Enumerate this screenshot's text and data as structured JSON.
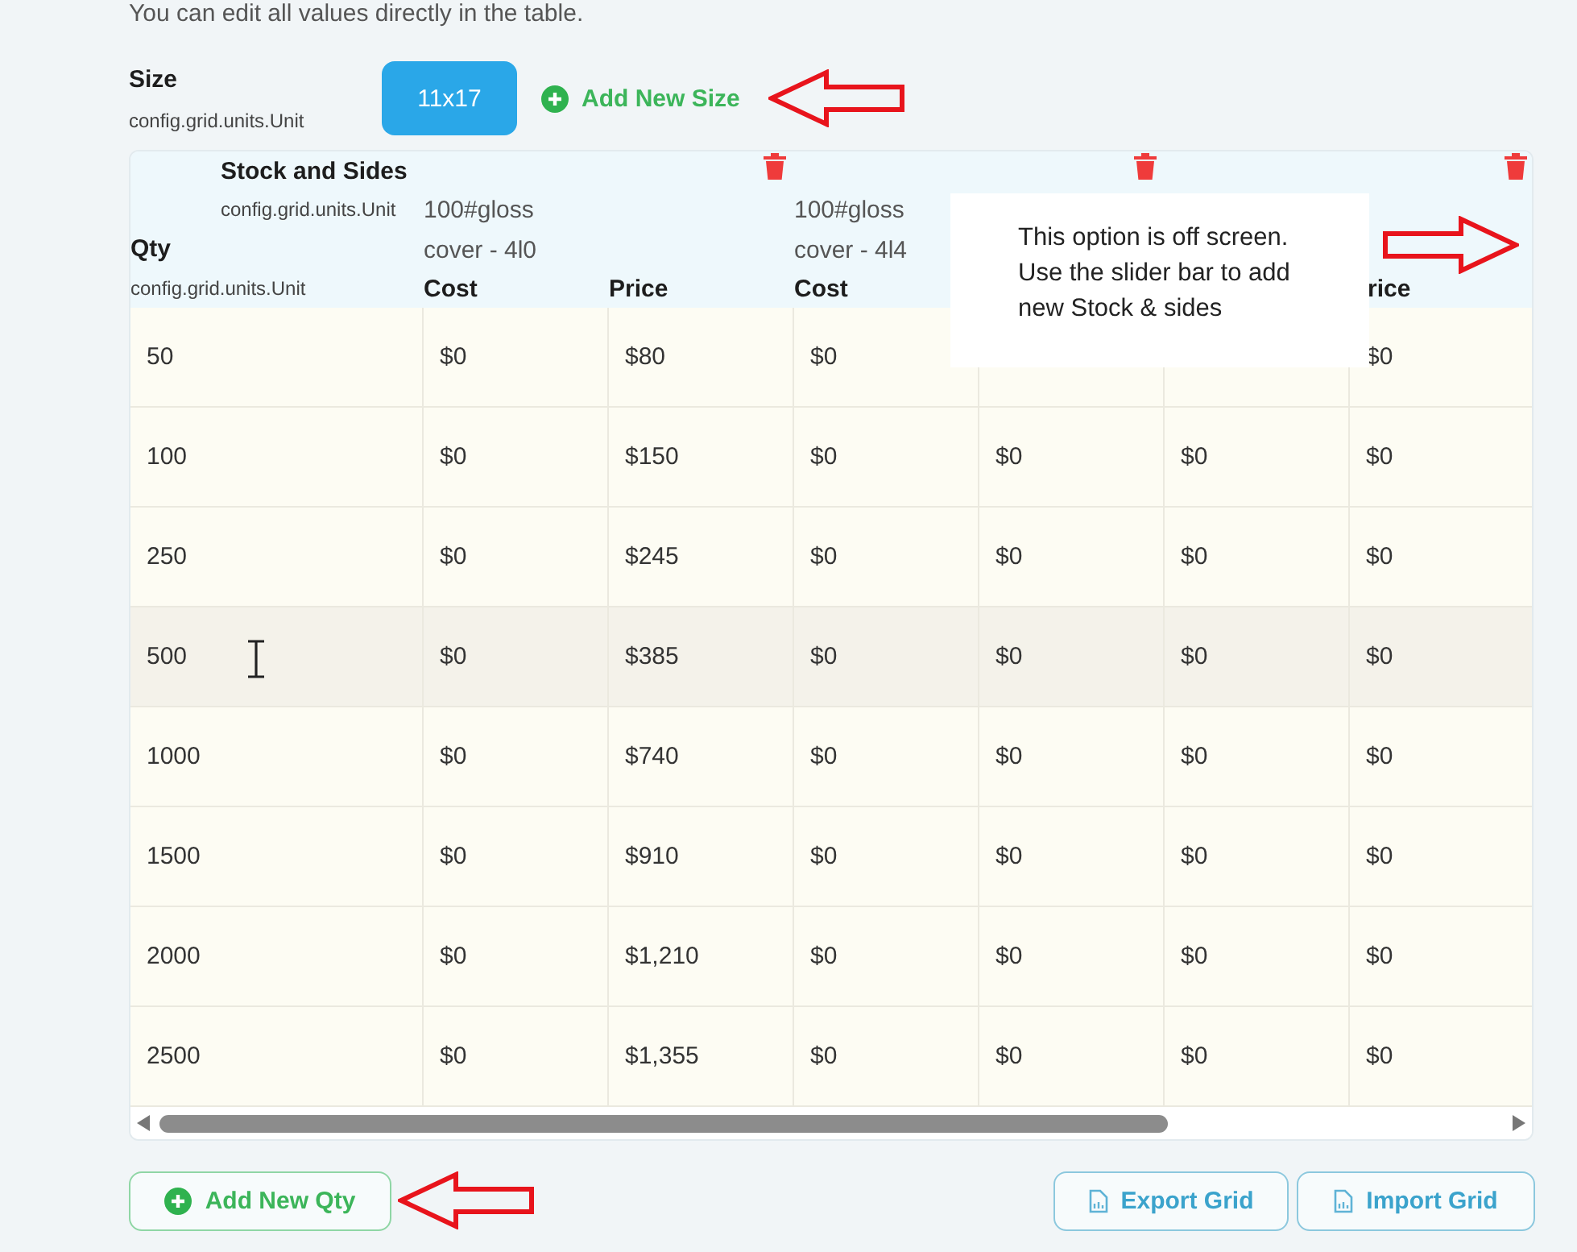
{
  "intro": "You can edit all values directly in the table.",
  "size": {
    "label": "Size",
    "sublabel": "config.grid.units.Unit",
    "options": [
      {
        "label": "11x17",
        "selected": true
      }
    ],
    "add_button": "Add New Size"
  },
  "grid": {
    "title": "Stock and Sides",
    "title_sublabel": "config.grid.units.Unit",
    "qty_label": "Qty",
    "qty_sublabel": "config.grid.units.Unit",
    "stocks": [
      {
        "lines": [
          "100#gloss",
          "cover - 4l0"
        ],
        "columns": [
          {
            "label": "Cost"
          },
          {
            "label": "Price"
          }
        ]
      },
      {
        "lines": [
          "100#gloss",
          "cover - 4l4"
        ],
        "columns": [
          {
            "label": "Cost"
          },
          {
            "covered": true
          }
        ]
      },
      {
        "columns": [
          {
            "covered": true
          },
          {
            "label": "rice"
          }
        ]
      }
    ],
    "rows": [
      {
        "qty": "50",
        "values": [
          "$0",
          "$80",
          "$0",
          {
            "covered": true
          },
          {
            "covered": true
          },
          "$0"
        ],
        "hovered": false
      },
      {
        "qty": "100",
        "values": [
          "$0",
          "$150",
          "$0",
          "$0",
          "$0",
          "$0"
        ],
        "hovered": false
      },
      {
        "qty": "250",
        "values": [
          "$0",
          "$245",
          "$0",
          "$0",
          "$0",
          "$0"
        ],
        "hovered": false
      },
      {
        "qty": "500",
        "values": [
          "$0",
          "$385",
          "$0",
          "$0",
          "$0",
          "$0"
        ],
        "hovered": true
      },
      {
        "qty": "1000",
        "values": [
          "$0",
          "$740",
          "$0",
          "$0",
          "$0",
          "$0"
        ],
        "hovered": false
      },
      {
        "qty": "1500",
        "values": [
          "$0",
          "$910",
          "$0",
          "$0",
          "$0",
          "$0"
        ],
        "hovered": false
      },
      {
        "qty": "2000",
        "values": [
          "$0",
          "$1,210",
          "$0",
          "$0",
          "$0",
          "$0"
        ],
        "hovered": false
      },
      {
        "qty": "2500",
        "values": [
          "$0",
          "$1,355",
          "$0",
          "$0",
          "$0",
          "$0"
        ],
        "hovered": false
      }
    ]
  },
  "callout": {
    "text": "This option is off screen. Use the slider bar to add new Stock & sides"
  },
  "actions": {
    "add_qty": "Add New Qty",
    "export": "Export Grid",
    "import": "Import Grid"
  }
}
